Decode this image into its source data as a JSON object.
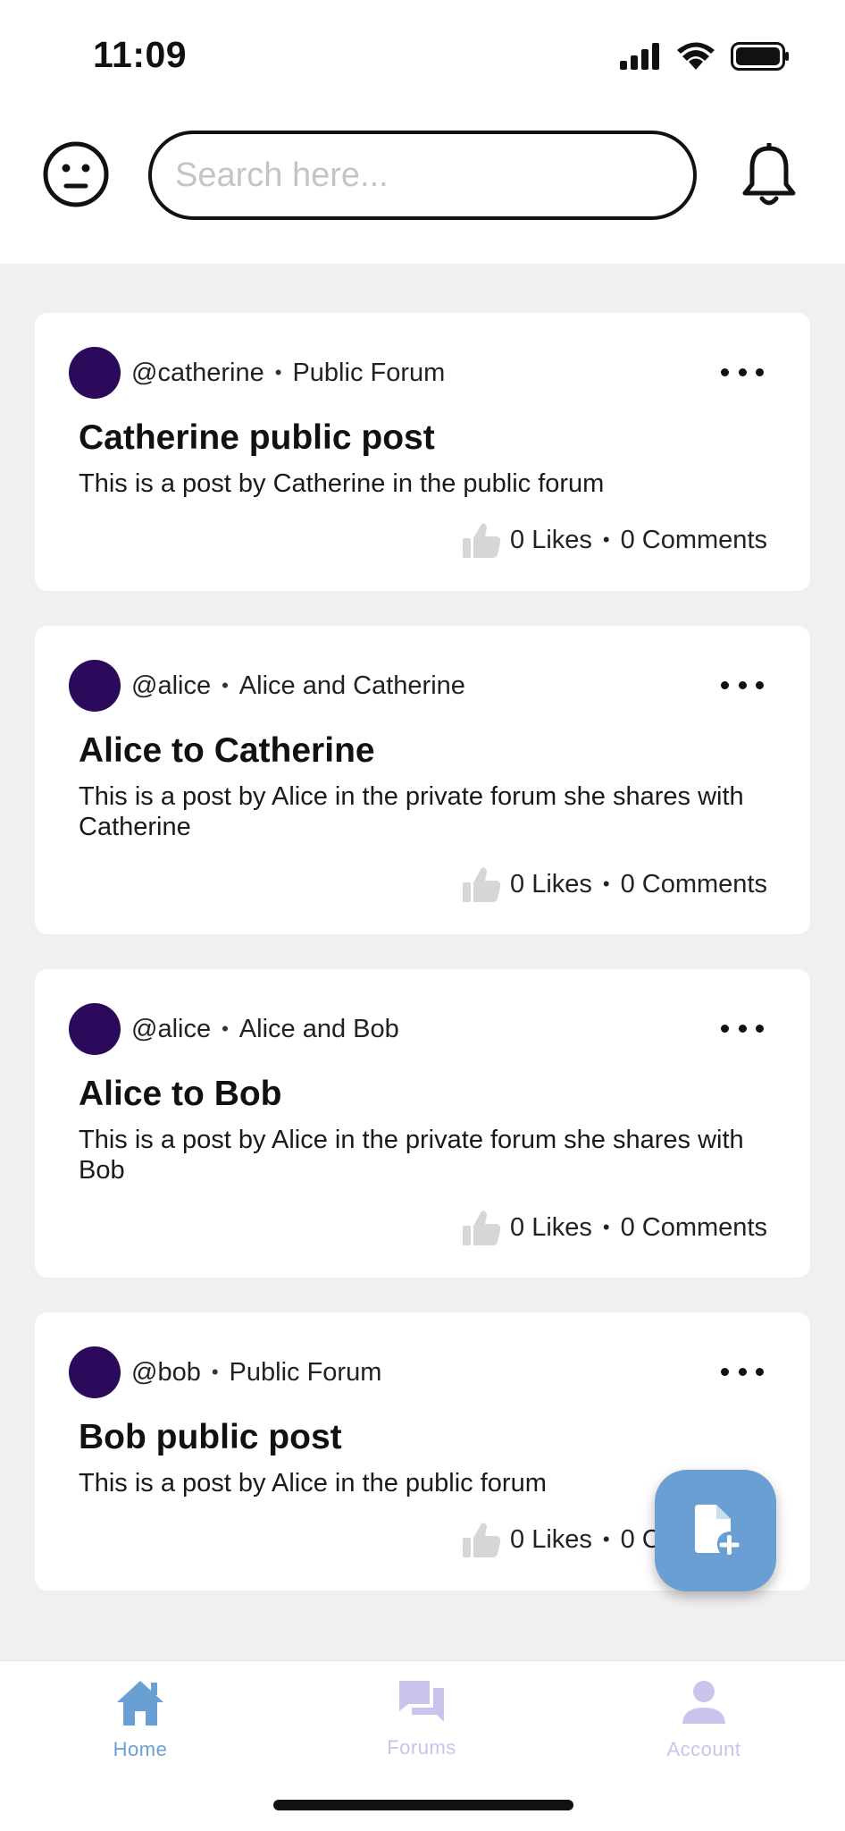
{
  "status": {
    "time": "11:09"
  },
  "search": {
    "placeholder": "Search here..."
  },
  "posts": [
    {
      "author": "@catherine",
      "forum": "Public Forum",
      "title": "Catherine public post",
      "body": "This is a post by Catherine in the public forum",
      "likes": "0 Likes",
      "comments": "0 Comments"
    },
    {
      "author": "@alice",
      "forum": "Alice and Catherine",
      "title": "Alice to Catherine",
      "body": "This is a post by Alice in the private forum she shares with Catherine",
      "likes": "0 Likes",
      "comments": "0 Comments"
    },
    {
      "author": "@alice",
      "forum": "Alice and Bob",
      "title": "Alice to Bob",
      "body": "This is a post by Alice in the private forum she shares with Bob",
      "likes": "0 Likes",
      "comments": "0 Comments"
    },
    {
      "author": "@bob",
      "forum": "Public Forum",
      "title": "Bob public post",
      "body": "This is a post by Alice in the public forum",
      "likes": "0 Likes",
      "comments": "0 Comments"
    }
  ],
  "nav": {
    "home": "Home",
    "forums": "Forums",
    "account": "Account"
  },
  "colors": {
    "avatar": "#2b0a5c",
    "accent": "#6a9fd3",
    "nav_active": "#6a9fd3",
    "nav_inactive": "#c9c3ee",
    "thumb": "#d6d6d6"
  },
  "icons": {
    "profile": "neutral-face-icon",
    "notifications": "bell-icon",
    "fab": "new-post-icon",
    "home": "home-icon",
    "forums": "chat-bubbles-icon",
    "account": "person-icon",
    "like": "thumbs-up-icon"
  }
}
